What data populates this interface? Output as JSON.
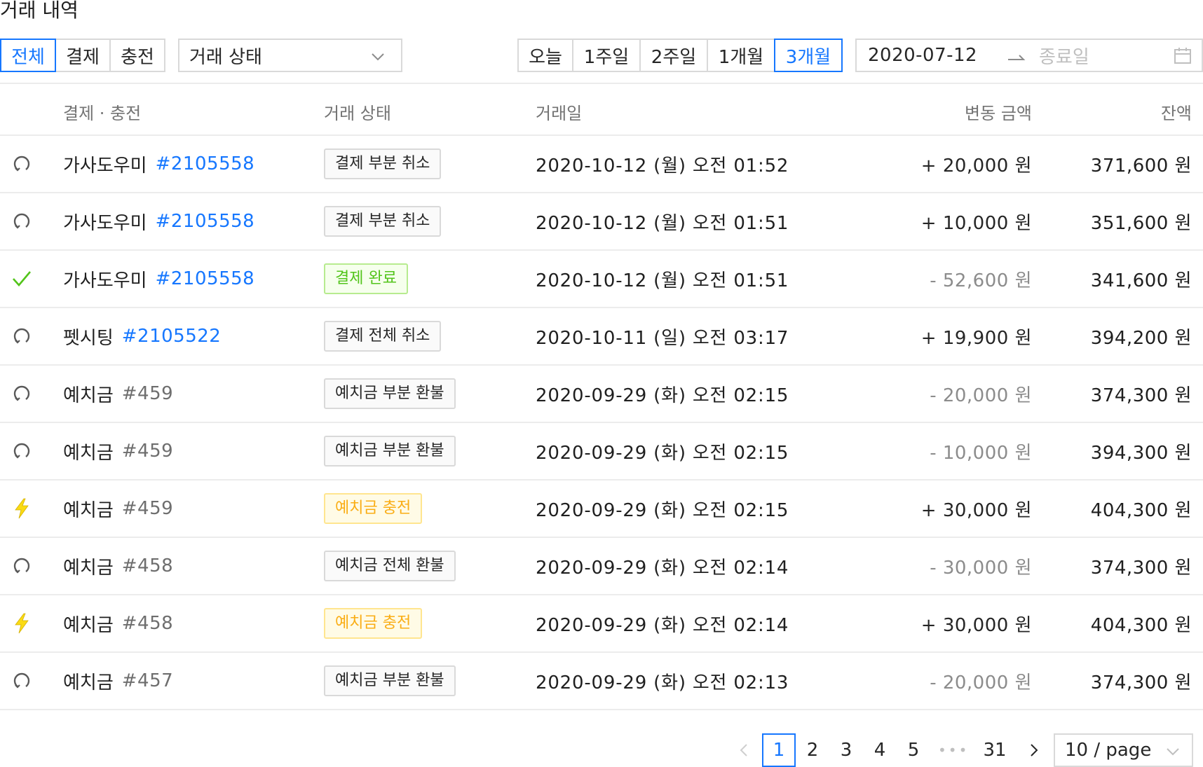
{
  "title": "거래 내역",
  "type_filter": {
    "options": [
      "전체",
      "결제",
      "충전"
    ],
    "active": "전체"
  },
  "status_filter": {
    "value": "거래 상태"
  },
  "period_filter": {
    "options": [
      "오늘",
      "1주일",
      "2주일",
      "1개월",
      "3개월"
    ],
    "active": "3개월"
  },
  "date_range": {
    "start": "2020-07-12",
    "end_placeholder": "종료일"
  },
  "columns": {
    "name": "결제 · 충전",
    "status": "거래 상태",
    "date": "거래일",
    "amount": "변동 금액",
    "balance": "잔액"
  },
  "rows": [
    {
      "icon": "refund-icon",
      "name": "가사도우미",
      "id": "#2105558",
      "id_style": "link",
      "status": "결제 부분 취소",
      "status_style": "default",
      "date": "2020-10-12 (월) 오전 01:52",
      "amount": "+ 20,000 원",
      "amount_sign": "plus",
      "balance": "371,600 원"
    },
    {
      "icon": "refund-icon",
      "name": "가사도우미",
      "id": "#2105558",
      "id_style": "link",
      "status": "결제 부분 취소",
      "status_style": "default",
      "date": "2020-10-12 (월) 오전 01:51",
      "amount": "+ 10,000 원",
      "amount_sign": "plus",
      "balance": "351,600 원"
    },
    {
      "icon": "check-icon",
      "name": "가사도우미",
      "id": "#2105558",
      "id_style": "link",
      "status": "결제 완료",
      "status_style": "success",
      "date": "2020-10-12 (월) 오전 01:51",
      "amount": "- 52,600 원",
      "amount_sign": "minus",
      "balance": "341,600 원"
    },
    {
      "icon": "refund-icon",
      "name": "펫시팅",
      "id": "#2105522",
      "id_style": "link",
      "status": "결제 전체 취소",
      "status_style": "default",
      "date": "2020-10-11 (일) 오전 03:17",
      "amount": "+ 19,900 원",
      "amount_sign": "plus",
      "balance": "394,200 원"
    },
    {
      "icon": "refund-icon",
      "name": "예치금",
      "id": "#459",
      "id_style": "plain",
      "status": "예치금 부분 환불",
      "status_style": "default",
      "date": "2020-09-29 (화) 오전 02:15",
      "amount": "- 20,000 원",
      "amount_sign": "minus",
      "balance": "374,300 원"
    },
    {
      "icon": "refund-icon",
      "name": "예치금",
      "id": "#459",
      "id_style": "plain",
      "status": "예치금 부분 환불",
      "status_style": "default",
      "date": "2020-09-29 (화) 오전 02:15",
      "amount": "- 10,000 원",
      "amount_sign": "minus",
      "balance": "394,300 원"
    },
    {
      "icon": "lightning-icon",
      "name": "예치금",
      "id": "#459",
      "id_style": "plain",
      "status": "예치금 충전",
      "status_style": "warning",
      "date": "2020-09-29 (화) 오전 02:15",
      "amount": "+ 30,000 원",
      "amount_sign": "plus",
      "balance": "404,300 원"
    },
    {
      "icon": "refund-icon",
      "name": "예치금",
      "id": "#458",
      "id_style": "plain",
      "status": "예치금 전체 환불",
      "status_style": "default",
      "date": "2020-09-29 (화) 오전 02:14",
      "amount": "- 30,000 원",
      "amount_sign": "minus",
      "balance": "374,300 원"
    },
    {
      "icon": "lightning-icon",
      "name": "예치금",
      "id": "#458",
      "id_style": "plain",
      "status": "예치금 충전",
      "status_style": "warning",
      "date": "2020-09-29 (화) 오전 02:14",
      "amount": "+ 30,000 원",
      "amount_sign": "plus",
      "balance": "404,300 원"
    },
    {
      "icon": "refund-icon",
      "name": "예치금",
      "id": "#457",
      "id_style": "plain",
      "status": "예치금 부분 환불",
      "status_style": "default",
      "date": "2020-09-29 (화) 오전 02:13",
      "amount": "- 20,000 원",
      "amount_sign": "minus",
      "balance": "374,300 원"
    }
  ],
  "pagination": {
    "pages": [
      "1",
      "2",
      "3",
      "4",
      "5"
    ],
    "current": "1",
    "last": "31",
    "page_size": "10 / page"
  },
  "colors": {
    "accent": "#1677ff",
    "success": "#52c41a",
    "warning": "#faad14",
    "border": "#d9d9d9"
  }
}
